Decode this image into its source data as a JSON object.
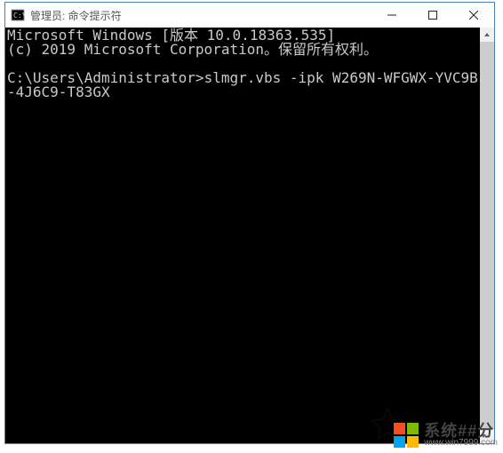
{
  "window": {
    "title": "管理员: 命令提示符"
  },
  "terminal": {
    "line1": "Microsoft Windows [版本 10.0.18363.535]",
    "line2": "(c) 2019 Microsoft Corporation。保留所有权利。",
    "blank": "",
    "prompt": "C:\\Users\\Administrator>",
    "command": "slmgr.vbs -ipk W269N-WFGWX-YVC9B-4J6C9-T83GX"
  },
  "watermark": {
    "brand_cn": "系统##分",
    "brand_url": "www.win7999.com",
    "colors": {
      "tl": "#f25022",
      "tr": "#7fba00",
      "bl": "#00a4ef",
      "br": "#ffb900"
    }
  }
}
